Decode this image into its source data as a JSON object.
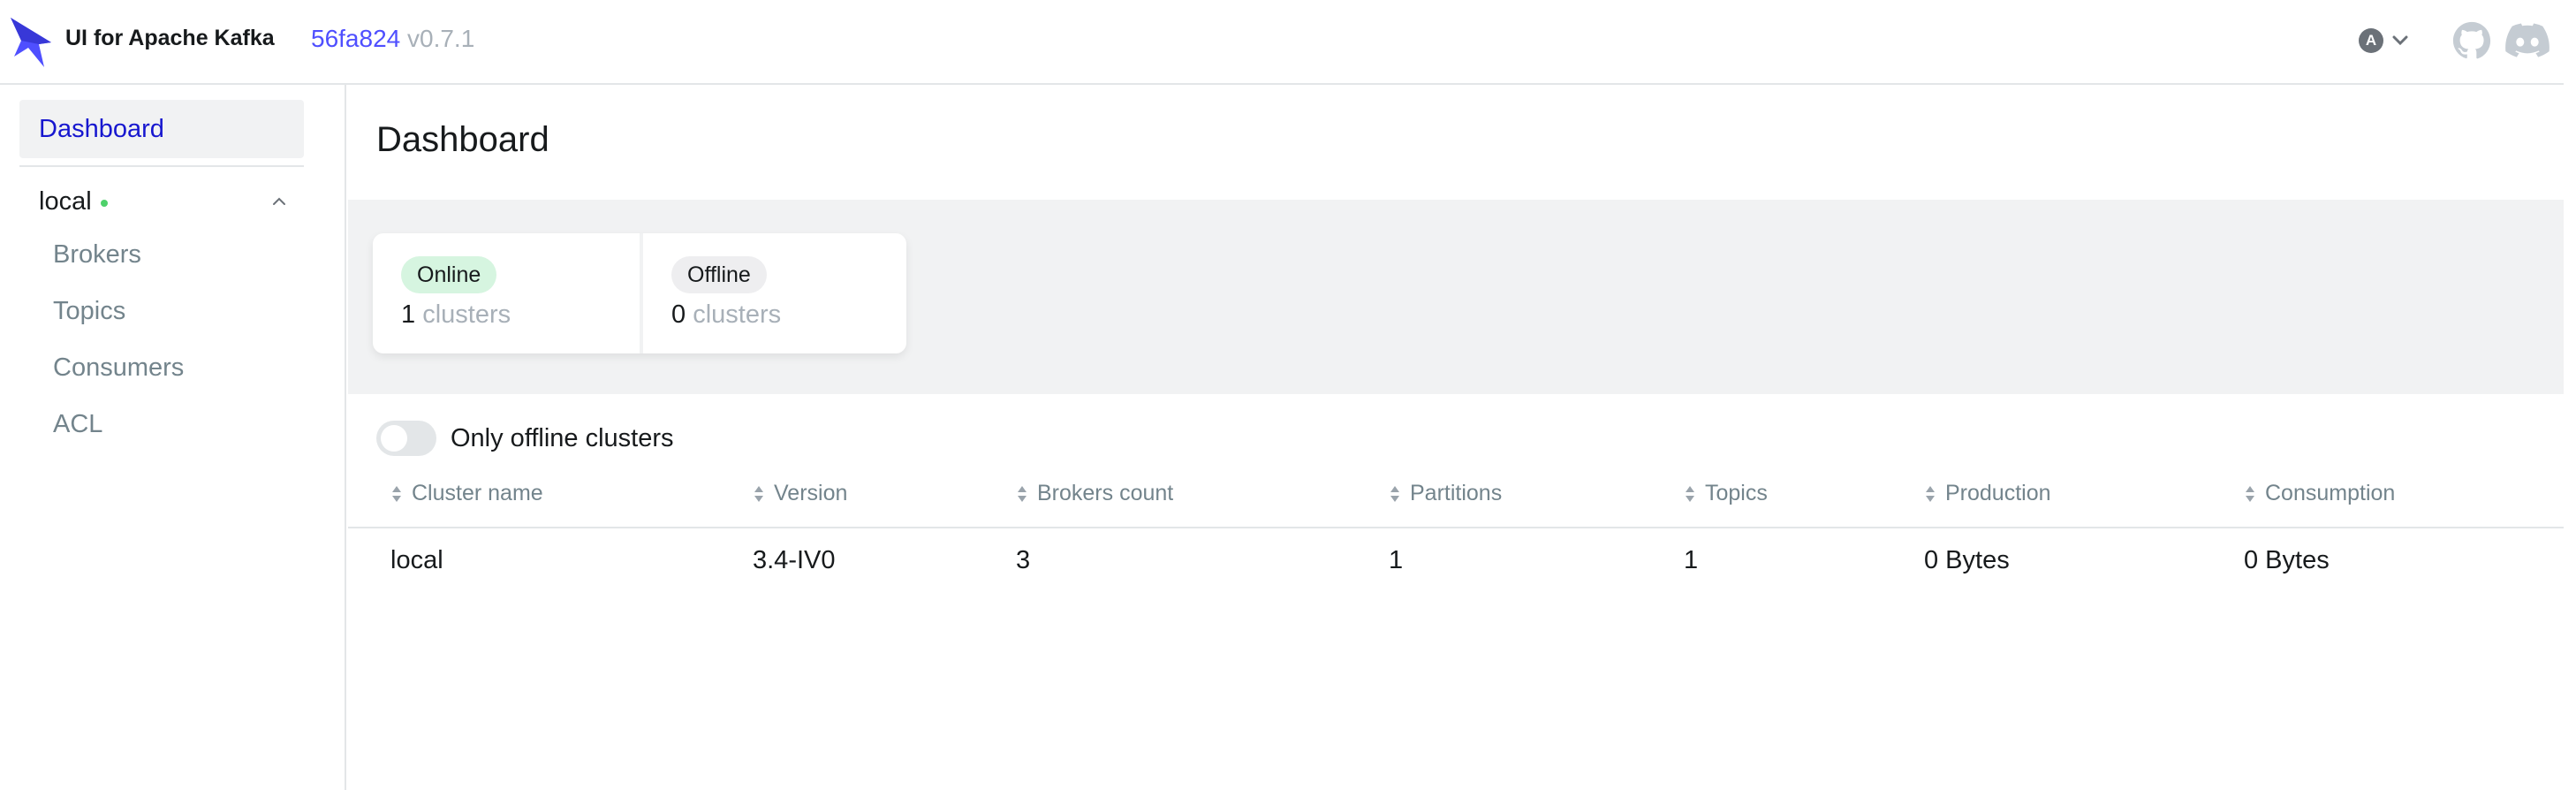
{
  "app": {
    "title": "UI for Apache Kafka",
    "commit": "56fa824",
    "version": "v0.7.1",
    "user_initial": "A",
    "brand_color": "#4f4fff"
  },
  "sidebar": {
    "dashboard_label": "Dashboard",
    "cluster": {
      "name": "local",
      "status_color": "#4ed16b",
      "items": [
        {
          "label": "Brokers"
        },
        {
          "label": "Topics"
        },
        {
          "label": "Consumers"
        },
        {
          "label": "ACL"
        }
      ]
    }
  },
  "main": {
    "title": "Dashboard",
    "metrics": [
      {
        "label": "Online",
        "value": "1",
        "unit": "clusters",
        "color": "#d6f5e0"
      },
      {
        "label": "Offline",
        "value": "0",
        "unit": "clusters",
        "color": "#eeeef0"
      }
    ],
    "toggle_label": "Only offline clusters",
    "table": {
      "columns": [
        "Cluster name",
        "Version",
        "Brokers count",
        "Partitions",
        "Topics",
        "Production",
        "Consumption"
      ],
      "rows": [
        [
          "local",
          "3.4-IV0",
          "3",
          "1",
          "1",
          "0 Bytes",
          "0 Bytes"
        ]
      ]
    }
  },
  "icons": [
    "kafka-logo",
    "chevron-down-icon",
    "github-icon",
    "discord-icon",
    "chevron-up-icon",
    "sort-icon"
  ]
}
